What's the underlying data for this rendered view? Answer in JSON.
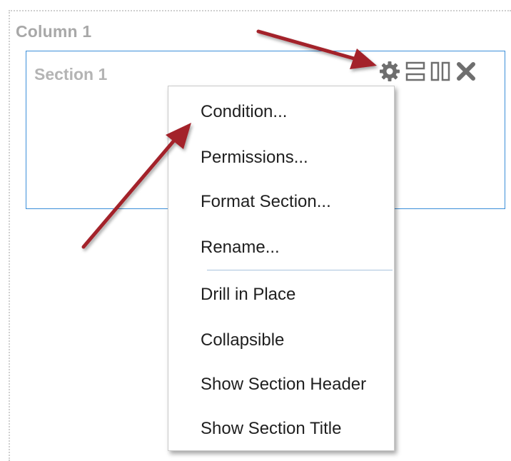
{
  "column": {
    "title": "Column 1"
  },
  "section": {
    "title": "Section 1",
    "tools": [
      {
        "name": "gear-icon"
      },
      {
        "name": "rows-icon"
      },
      {
        "name": "columns-icon"
      },
      {
        "name": "close-icon"
      }
    ]
  },
  "menu": {
    "items": [
      {
        "label": "Condition..."
      },
      {
        "label": "Permissions..."
      },
      {
        "label": "Format Section..."
      },
      {
        "label": "Rename..."
      },
      {
        "label": "Drill in Place"
      },
      {
        "label": "Collapsible"
      },
      {
        "label": "Show Section Header"
      },
      {
        "label": "Show Section Title"
      }
    ]
  },
  "colors": {
    "section_border": "#3b8fd9",
    "annotation_arrow": "#a3222c",
    "icon": "#6e6e6e",
    "separator": "#a9c4de"
  }
}
